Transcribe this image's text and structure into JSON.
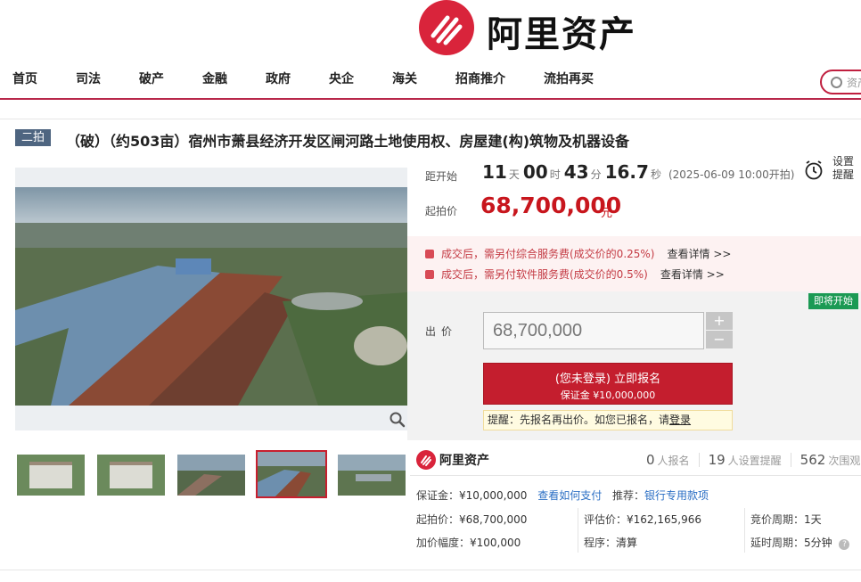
{
  "brand": {
    "name": "阿里资产",
    "color": "#d9243b"
  },
  "nav": {
    "items": [
      "首页",
      "司法",
      "破产",
      "金融",
      "政府",
      "央企",
      "海关",
      "招商推介",
      "流拍再买"
    ]
  },
  "search": {
    "placeholder": "资产"
  },
  "title": {
    "badge": "二拍",
    "text": "（破）（约503亩）宿州市萧县经济开发区闸河路土地使用权、房屋建(构)筑物及机器设备"
  },
  "countdown": {
    "label": "距开始",
    "days": "11",
    "days_unit": "天",
    "hours": "00",
    "hours_unit": "时",
    "minutes": "43",
    "minutes_unit": "分",
    "seconds": "16.7",
    "seconds_unit": "秒",
    "start_text": "(2025-06-09 10:00开拍)"
  },
  "reminder": {
    "label": "设置提醒"
  },
  "start_price": {
    "label": "起拍价",
    "value": "68,700,000",
    "unit": "元"
  },
  "fees": [
    {
      "text": "成交后，需另付综合服务费(成交价的0.25%)",
      "link": "查看详情 >>"
    },
    {
      "text": "成交后，需另付软件服务费(成交价的0.5%)",
      "link": "查看详情 >>"
    }
  ],
  "bid": {
    "status_badge": "即将开始",
    "label": "出价",
    "value": "68,700,000",
    "plus": "+",
    "minus": "−",
    "button_main": "(您未登录) 立即报名",
    "button_sub": "保证金 ¥10,000,000",
    "tip_text": "提醒：先报名再出价。如您已报名，请",
    "tip_link": "登录"
  },
  "info": {
    "logo_text": "阿里资产",
    "stats": [
      {
        "num": "0",
        "label": "人报名"
      },
      {
        "num": "19",
        "label": "人设置提醒"
      },
      {
        "num": "562",
        "label": "次围观"
      }
    ],
    "deposit_label": "保证金：",
    "deposit_value": "¥10,000,000",
    "deposit_link": "查看如何支付",
    "recommend_label": "推荐：",
    "recommend_link": "银行专用款项",
    "start_price_label": "起拍价：",
    "start_price_value": "¥68,700,000",
    "eval_label": "评估价：",
    "eval_value": "¥162,165,966",
    "period_label": "竞价周期：",
    "period_value": "1天",
    "increment_label": "加价幅度：",
    "increment_value": "¥100,000",
    "procedure_label": "程序：",
    "procedure_value": "清算",
    "delay_label": "延时周期：",
    "delay_value": "5分钟"
  },
  "colors": {
    "accent": "#c8161d",
    "green_badge": "#1b9a54",
    "round_badge": "#4e6580"
  }
}
